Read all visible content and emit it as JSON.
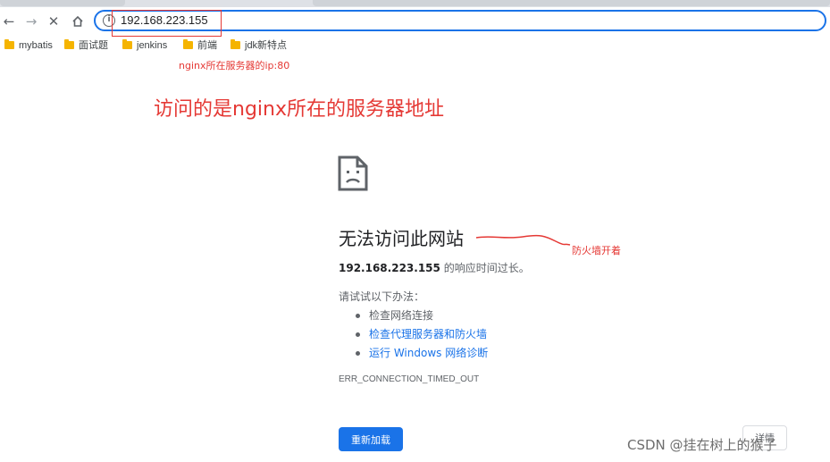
{
  "toolbar": {
    "back_icon": "back-arrow-icon",
    "forward_icon": "forward-arrow-icon",
    "stop_icon": "close-icon",
    "home_icon": "home-icon",
    "url": "192.168.223.155"
  },
  "bookmarks": [
    {
      "label": "mybatis"
    },
    {
      "label": "面试题"
    },
    {
      "label": "jenkins"
    },
    {
      "label": "前端"
    },
    {
      "label": "jdk新特点"
    }
  ],
  "annotations": {
    "small": "nginx所在服务器的ip:80",
    "big": "访问的是nginx所在的服务器地址",
    "firewall": "防火墙开着",
    "color": "#e53935"
  },
  "error_page": {
    "title": "无法访问此网站",
    "host": "192.168.223.155",
    "desc_suffix": " 的响应时间过长。",
    "try_label": "请试试以下办法：",
    "suggestions": [
      {
        "label": "检查网络连接"
      },
      {
        "label": "检查代理服务器和防火墙"
      },
      {
        "label": "运行 Windows 网络诊断"
      }
    ],
    "error_code": "ERR_CONNECTION_TIMED_OUT",
    "reload_label": "重新加载",
    "details_label": "详情",
    "accent_color": "#1a73e8"
  },
  "watermark": "CSDN @挂在树上的猴子"
}
